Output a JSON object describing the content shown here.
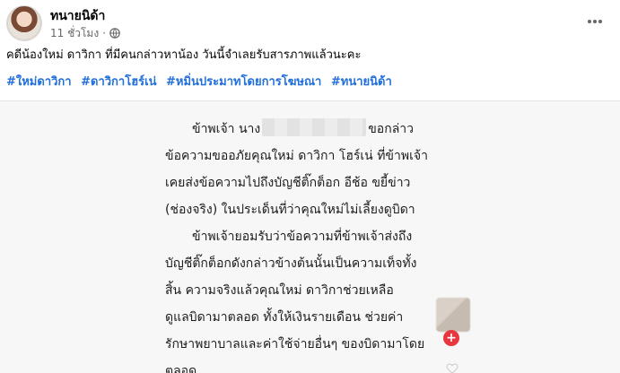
{
  "post": {
    "author": "ทนายนิด้า",
    "time": "11 ชั่วโมง",
    "separator": "·",
    "privacy_icon": "globe-icon",
    "more_icon": "more-horizontal-icon",
    "caption": "คดีน้องใหม่ ดาวิกา ที่มีคนกล่าวหาน้อง วันนี้จำเลยรับสารภาพแล้วนะคะ",
    "hashtags": [
      "#ใหม่ดาวิกา",
      "#ดาวิกาโฮร์เน่",
      "#หมิ่นประมาทโดยการโฆษณา",
      "#ทนายนิด้า"
    ]
  },
  "letter": {
    "line1_start": "ข้าพเจ้า นาง",
    "line1_end": "ขอกล่าว",
    "line2": "ข้อความขออภัยคุณใหม่ ดาวิกา โฮร์เน่ ที่ข้าพเจ้า",
    "line3": "เคยส่งข้อความไปถึงบัญชีติ๊กต็อก อีช้อ ขยี้ข่าว",
    "line4": "(ช่องจริง) ในประเด็นที่ว่าคุณใหม่ไม่เลี้ยงดูบิดา",
    "line5": "ข้าพเจ้ายอมรับว่าข้อความที่ข้าพเจ้าส่งถึง",
    "line6": "บัญชีติ๊กต็อกดังกล่าวข้างต้นนั้นเป็นความเท็จทั้ง",
    "line7": "สิ้น ความจริงแล้วคุณใหม่ ดาวิกาช่วยเหลือ",
    "line8": "ดูแลบิดามาตลอด ทั้งให้เงินรายเดือน ช่วยค่า",
    "line9": "รักษาพยาบาลและค่าใช้จ่ายอื่นๆ ของบิดามาโดย",
    "line10": "ตลอด"
  },
  "badge": {
    "plus": "+"
  },
  "colors": {
    "hashtag": "#216fdb",
    "meta": "#65676b",
    "badge": "#e8363f"
  }
}
